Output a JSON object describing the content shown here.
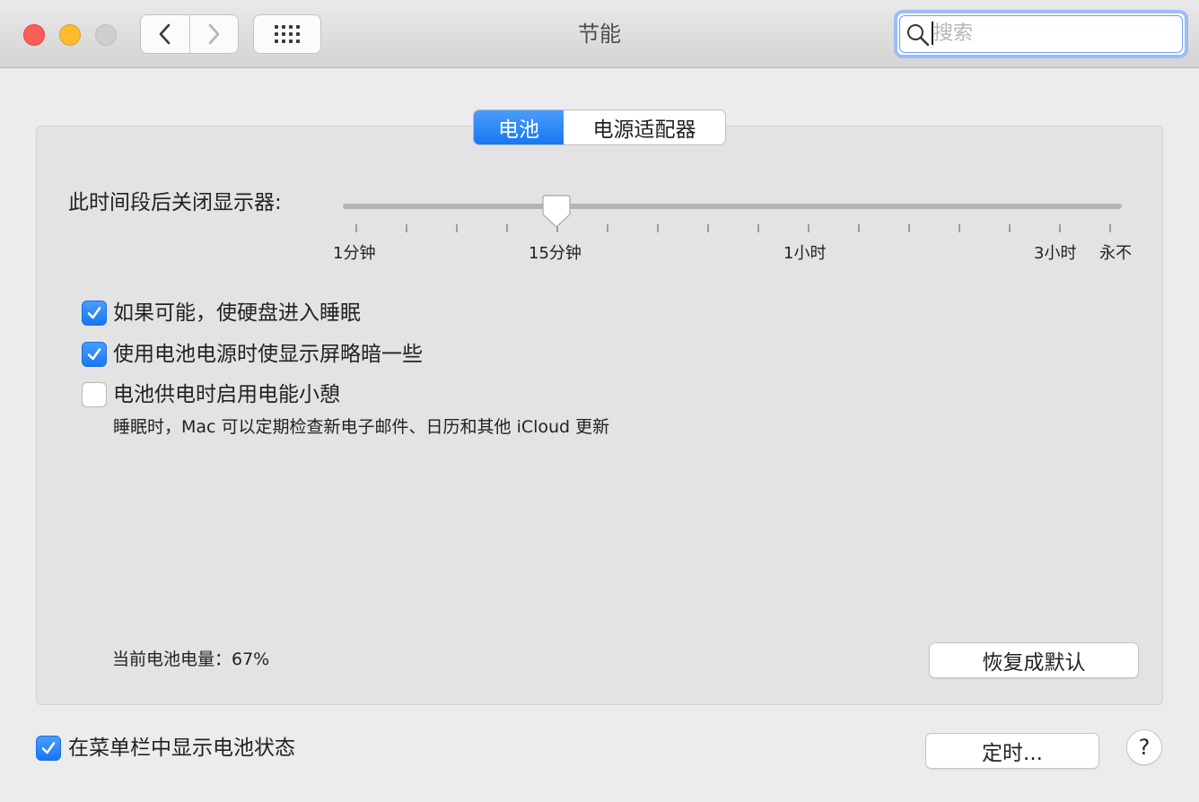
{
  "window": {
    "title": "节能"
  },
  "search": {
    "placeholder": "搜索",
    "value": ""
  },
  "tabs": [
    {
      "label": "电池",
      "active": true
    },
    {
      "label": "电源适配器",
      "active": false
    }
  ],
  "slider": {
    "label": "此时间段后关闭显示器:",
    "marks": [
      "1分钟",
      "15分钟",
      "1小时",
      "3小时",
      "永不"
    ],
    "selected": "15分钟"
  },
  "options": [
    {
      "label": "如果可能，使硬盘进入睡眠",
      "checked": true
    },
    {
      "label": "使用电池电源时使显示屏略暗一些",
      "checked": true
    },
    {
      "label": "电池供电时启用电能小憩",
      "checked": false
    }
  ],
  "power_nap_note": "睡眠时，Mac 可以定期检查新电子邮件、日历和其他 iCloud 更新",
  "battery": {
    "label": "当前电池电量：67%",
    "percent": 67
  },
  "buttons": {
    "restore_defaults": "恢复成默认",
    "schedule": "定时...",
    "help": "?"
  },
  "menu_bar_option": {
    "label": "在菜单栏中显示电池状态",
    "checked": true
  },
  "colors": {
    "accent": "#1a7cf5",
    "close": "#fc5f57",
    "minimize": "#fdbc2e",
    "zoom_disabled": "#cfcfcf"
  }
}
